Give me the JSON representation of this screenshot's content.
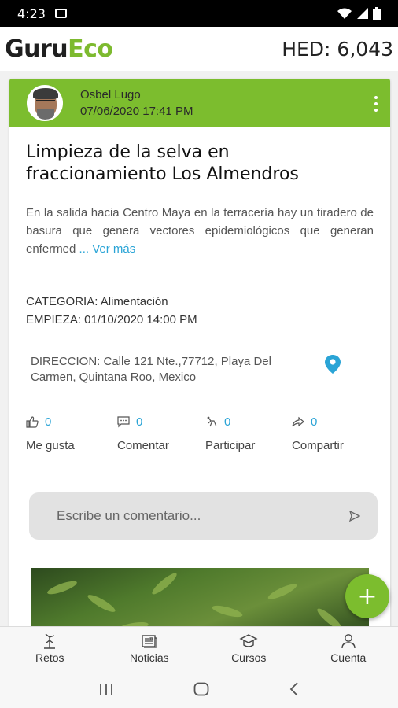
{
  "status_bar": {
    "time": "4:23"
  },
  "app_bar": {
    "logo_part1": "Guru",
    "logo_part2": "Eco",
    "hed": "HED: 6,043"
  },
  "post": {
    "author": "Osbel Lugo",
    "datetime": "07/06/2020 17:41 PM",
    "title": "Limpieza de la selva en fraccionamiento Los Almendros",
    "description": "En la salida hacia Centro Maya en la terracería hay un tiradero de basura que genera vectores epidemiológicos que generan enfermed",
    "more_link": "... Ver más",
    "category": "CATEGORIA: Alimentación",
    "starts": "EMPIEZA: 01/10/2020 14:00 PM",
    "address": "DIRECCION: Calle 121 Nte.,77712, Playa Del Carmen, Quintana Roo, Mexico",
    "actions": [
      {
        "label": "Me gusta",
        "count": "0",
        "icon": "thumbs-up-icon"
      },
      {
        "label": "Comentar",
        "count": "0",
        "icon": "comment-icon"
      },
      {
        "label": "Participar",
        "count": "0",
        "icon": "participate-icon"
      },
      {
        "label": "Compartir",
        "count": "0",
        "icon": "share-icon"
      }
    ]
  },
  "comment_box": {
    "placeholder": "Escribe un comentario..."
  },
  "fab": {
    "label": "+"
  },
  "bottom_nav": [
    {
      "label": "Retos",
      "icon": "challenges-icon"
    },
    {
      "label": "Noticias",
      "icon": "news-icon"
    },
    {
      "label": "Cursos",
      "icon": "courses-icon"
    },
    {
      "label": "Cuenta",
      "icon": "account-icon"
    }
  ],
  "colors": {
    "brand_green": "#7cbd2e",
    "link_blue": "#2aa4d6"
  }
}
